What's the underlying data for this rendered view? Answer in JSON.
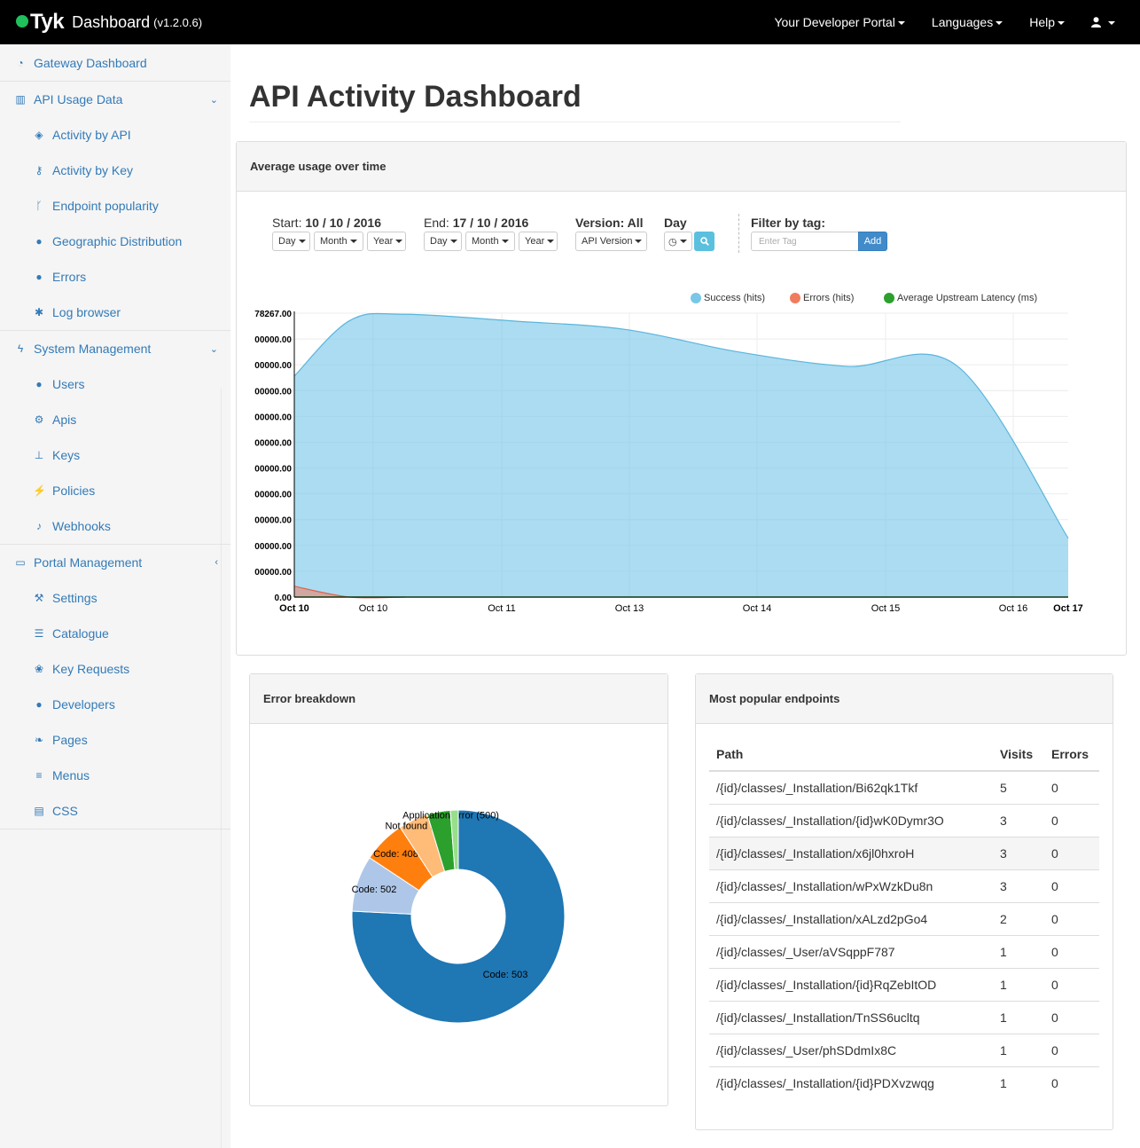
{
  "topbar": {
    "logo": "Tyk",
    "title": "Dashboard",
    "version": "(v1.2.0.6)",
    "nav": [
      "Your Developer Portal",
      "Languages",
      "Help"
    ],
    "user_icon": "user-icon"
  },
  "sidebar": {
    "gateway": "Gateway Dashboard",
    "api_usage": {
      "label": "API Usage Data",
      "items": [
        "Activity by API",
        "Activity by Key",
        "Endpoint popularity",
        "Geographic Distribution",
        "Errors",
        "Log browser"
      ]
    },
    "system": {
      "label": "System Management",
      "items": [
        "Users",
        "Apis",
        "Keys",
        "Policies",
        "Webhooks"
      ]
    },
    "portal": {
      "label": "Portal Management",
      "items": [
        "Settings",
        "Catalogue",
        "Key Requests",
        "Developers",
        "Pages",
        "Menus",
        "CSS"
      ]
    }
  },
  "page": {
    "title": "API Activity Dashboard"
  },
  "usage_panel": {
    "heading": "Average usage over time",
    "start_label": "Start:",
    "start_value": "10 / 10 / 2016",
    "end_label": "End:",
    "end_value": "17 / 10 / 2016",
    "version_label": "Version:",
    "version_value": "All",
    "day_label": "Day",
    "filter_label": "Filter by tag:",
    "dropdowns": [
      "Day",
      "Month",
      "Year"
    ],
    "api_version_dropdown": "API Version",
    "tag_placeholder": "Enter Tag",
    "add_label": "Add"
  },
  "error_panel": {
    "heading": "Error breakdown"
  },
  "endpoints_panel": {
    "heading": "Most popular endpoints",
    "columns": [
      "Path",
      "Visits",
      "Errors"
    ],
    "rows": [
      [
        "/{id}/classes/_Installation/Bi62qk1Tkf",
        "5",
        "0"
      ],
      [
        "/{id}/classes/_Installation/{id}wK0Dymr3O",
        "3",
        "0"
      ],
      [
        "/{id}/classes/_Installation/x6jl0hxroH",
        "3",
        "0"
      ],
      [
        "/{id}/classes/_Installation/wPxWzkDu8n",
        "3",
        "0"
      ],
      [
        "/{id}/classes/_Installation/xALzd2pGo4",
        "2",
        "0"
      ],
      [
        "/{id}/classes/_User/aVSqppF787",
        "1",
        "0"
      ],
      [
        "/{id}/classes/_Installation/{id}RqZebItOD",
        "1",
        "0"
      ],
      [
        "/{id}/classes/_Installation/TnSS6ucltq",
        "1",
        "0"
      ],
      [
        "/{id}/classes/_User/phSDdmIx8C",
        "1",
        "0"
      ],
      [
        "/{id}/classes/_Installation/{id}PDXvzwqg",
        "1",
        "0"
      ]
    ]
  },
  "colors": {
    "success": "#79c7e8",
    "errors": "#f07c5e",
    "latency": "#2ca02c",
    "link": "#337ab7"
  },
  "chart_data": [
    {
      "type": "area",
      "title": "",
      "legend": [
        "Success (hits)",
        "Errors (hits)",
        "Average Upstream Latency (ms)"
      ],
      "legend_position": "top-right",
      "y_top_label": "78267.00",
      "y_tick_labels": [
        "78267.00",
        "00000.00",
        "00000.00",
        "00000.00",
        "00000.00",
        "00000.00",
        "00000.00",
        "00000.00",
        "00000.00",
        "00000.00",
        "00000.00",
        "0.00"
      ],
      "x_tick_labels": [
        "Oct 10",
        "Oct 10",
        "Oct 11",
        "Oct 13",
        "Oct 14",
        "Oct 15",
        "Oct 16",
        "Oct 17"
      ],
      "ylim": [
        0,
        578267
      ],
      "series": [
        {
          "name": "Success (hits)",
          "x": [
            "Oct 10",
            "Oct 10 12:00",
            "Oct 11",
            "Oct 12",
            "Oct 13",
            "Oct 14",
            "Oct 15",
            "Oct 16",
            "Oct 17"
          ],
          "values": [
            450000,
            563000,
            576000,
            562000,
            545000,
            500000,
            470000,
            470000,
            120000
          ]
        },
        {
          "name": "Errors (hits)",
          "x": [
            "Oct 10",
            "Oct 10 12:00",
            "Oct 11"
          ],
          "values": [
            22000,
            0,
            0
          ]
        },
        {
          "name": "Average Upstream Latency (ms)",
          "x": [
            "Oct 10",
            "Oct 17"
          ],
          "values": [
            0,
            0
          ]
        }
      ]
    },
    {
      "type": "pie",
      "title": "",
      "slices": [
        {
          "label": "Code: 503",
          "value": 75.8
        },
        {
          "label": "Code: 502",
          "value": 8.5
        },
        {
          "label": "Code: 408",
          "value": 6.5
        },
        {
          "label": "Not found (404)",
          "value": 4.5
        },
        {
          "label": "Application error (500)",
          "value": 3.5
        },
        {
          "label": "",
          "value": 1.2
        }
      ]
    }
  ]
}
